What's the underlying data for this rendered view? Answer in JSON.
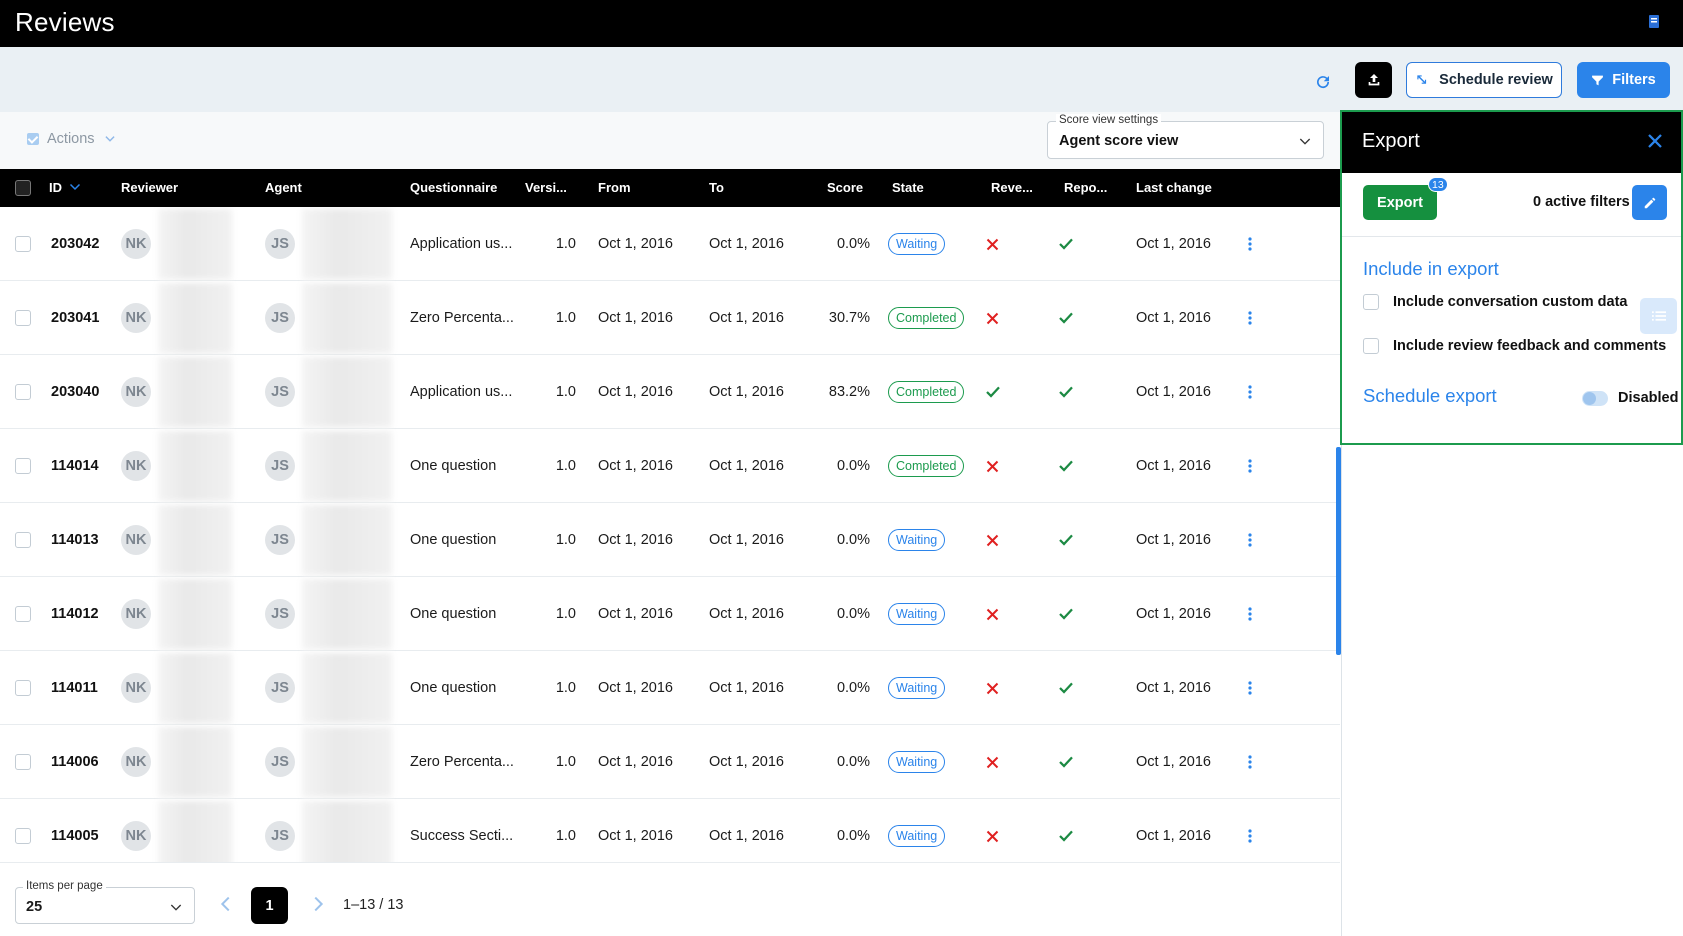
{
  "app": {
    "title": "Reviews"
  },
  "toolbar": {
    "refresh_icon": "refresh-icon",
    "upload_icon": "upload-icon",
    "schedule_label": "Schedule review",
    "filters_label": "Filters",
    "accent": "#2b84ea"
  },
  "actions": {
    "label": "Actions"
  },
  "score_view": {
    "label": "Score view settings",
    "value": "Agent score view"
  },
  "table": {
    "columns": [
      "ID",
      "Reviewer",
      "Agent",
      "Questionnaire",
      "Versi...",
      "From",
      "To",
      "Score",
      "State",
      "Reve...",
      "Repo...",
      "Last change"
    ],
    "rows": [
      {
        "id": "203042",
        "reviewer": "NK",
        "agent": "JS",
        "questionnaire": "Application us...",
        "version": "1.0",
        "from": "Oct 1, 2016",
        "to": "Oct 1, 2016",
        "score": "0.0%",
        "state": "Waiting",
        "reviewed": "no",
        "reported": "yes",
        "last_change": "Oct 1, 2016"
      },
      {
        "id": "203041",
        "reviewer": "NK",
        "agent": "JS",
        "questionnaire": "Zero Percenta...",
        "version": "1.0",
        "from": "Oct 1, 2016",
        "to": "Oct 1, 2016",
        "score": "30.7%",
        "state": "Completed",
        "reviewed": "no",
        "reported": "yes",
        "last_change": "Oct 1, 2016"
      },
      {
        "id": "203040",
        "reviewer": "NK",
        "agent": "JS",
        "questionnaire": "Application us...",
        "version": "1.0",
        "from": "Oct 1, 2016",
        "to": "Oct 1, 2016",
        "score": "83.2%",
        "state": "Completed",
        "reviewed": "yes",
        "reported": "yes",
        "last_change": "Oct 1, 2016"
      },
      {
        "id": "114014",
        "reviewer": "NK",
        "agent": "JS",
        "questionnaire": "One question",
        "version": "1.0",
        "from": "Oct 1, 2016",
        "to": "Oct 1, 2016",
        "score": "0.0%",
        "state": "Completed",
        "reviewed": "no",
        "reported": "yes",
        "last_change": "Oct 1, 2016"
      },
      {
        "id": "114013",
        "reviewer": "NK",
        "agent": "JS",
        "questionnaire": "One question",
        "version": "1.0",
        "from": "Oct 1, 2016",
        "to": "Oct 1, 2016",
        "score": "0.0%",
        "state": "Waiting",
        "reviewed": "no",
        "reported": "yes",
        "last_change": "Oct 1, 2016"
      },
      {
        "id": "114012",
        "reviewer": "NK",
        "agent": "JS",
        "questionnaire": "One question",
        "version": "1.0",
        "from": "Oct 1, 2016",
        "to": "Oct 1, 2016",
        "score": "0.0%",
        "state": "Waiting",
        "reviewed": "no",
        "reported": "yes",
        "last_change": "Oct 1, 2016"
      },
      {
        "id": "114011",
        "reviewer": "NK",
        "agent": "JS",
        "questionnaire": "One question",
        "version": "1.0",
        "from": "Oct 1, 2016",
        "to": "Oct 1, 2016",
        "score": "0.0%",
        "state": "Waiting",
        "reviewed": "no",
        "reported": "yes",
        "last_change": "Oct 1, 2016"
      },
      {
        "id": "114006",
        "reviewer": "NK",
        "agent": "JS",
        "questionnaire": "Zero Percenta...",
        "version": "1.0",
        "from": "Oct 1, 2016",
        "to": "Oct 1, 2016",
        "score": "0.0%",
        "state": "Waiting",
        "reviewed": "no",
        "reported": "yes",
        "last_change": "Oct 1, 2016"
      },
      {
        "id": "114005",
        "reviewer": "NK",
        "agent": "JS",
        "questionnaire": "Success Secti...",
        "version": "1.0",
        "from": "Oct 1, 2016",
        "to": "Oct 1, 2016",
        "score": "0.0%",
        "state": "Waiting",
        "reviewed": "no",
        "reported": "yes",
        "last_change": "Oct 1, 2016"
      }
    ]
  },
  "pagination": {
    "items_label": "Items per page",
    "items_value": "25",
    "current_page": "1",
    "range": "1–13 / 13"
  },
  "export_panel": {
    "title": "Export",
    "export_label": "Export",
    "export_count": "13",
    "active_filters": "0 active filters",
    "include_title": "Include in export",
    "option_custom_data": "Include conversation custom data",
    "option_feedback": "Include review feedback and comments",
    "schedule_title": "Schedule export",
    "schedule_state": "Disabled",
    "export_color": "#15903f"
  }
}
